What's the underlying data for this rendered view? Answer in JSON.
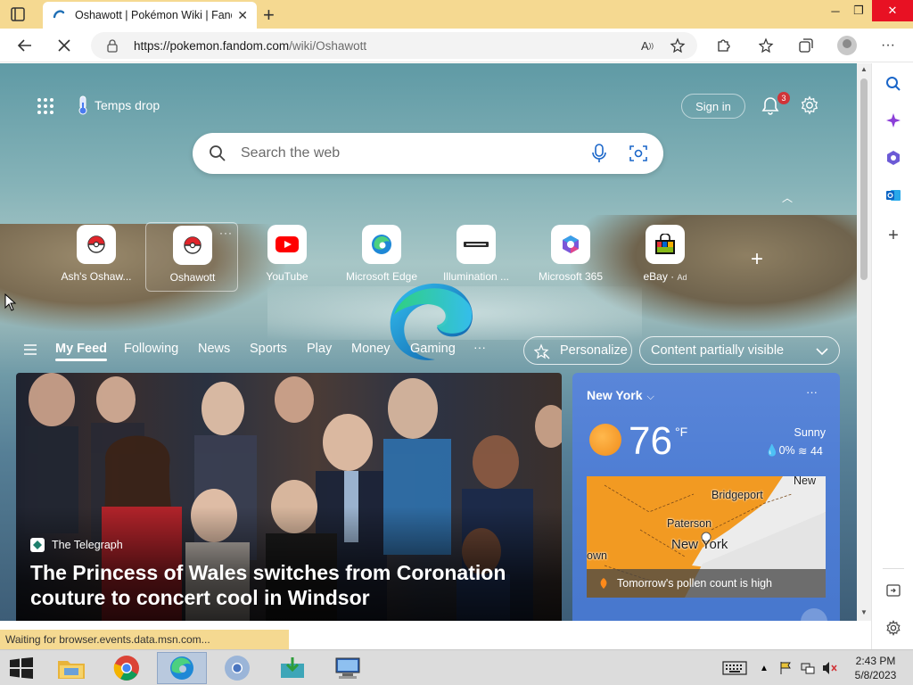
{
  "browser": {
    "tab_title": "Oshawott | Pokémon Wiki | Fandom",
    "url_host": "https://pokemon.fandom.com",
    "url_path": "/wiki/Oshawott"
  },
  "newtab": {
    "weather_chip": "Temps drop",
    "sign_in": "Sign in",
    "notification_count": "3",
    "search_placeholder": "Search the web",
    "tiles": [
      {
        "label": "Ash's Oshaw...",
        "icon": "pokeball-icon"
      },
      {
        "label": "Oshawott",
        "icon": "pokeball-icon"
      },
      {
        "label": "YouTube",
        "icon": "youtube-icon"
      },
      {
        "label": "Microsoft Edge",
        "icon": "edge-icon"
      },
      {
        "label": "Illumination ...",
        "icon": "illumination-icon"
      },
      {
        "label": "Microsoft 365",
        "icon": "microsoft-365-icon"
      },
      {
        "label": "eBay",
        "ad": "Ad",
        "icon": "ebay-icon"
      }
    ],
    "feed_nav": [
      "My Feed",
      "Following",
      "News",
      "Sports",
      "Play",
      "Money",
      "Gaming"
    ],
    "personalize": "Personalize",
    "content_visibility": "Content partially visible"
  },
  "hero": {
    "source": "The Telegraph",
    "title": "The Princess of Wales switches from Coronation couture to concert cool in Windsor"
  },
  "weather": {
    "location": "New York",
    "temperature": "76",
    "unit": "°F",
    "condition": "Sunny",
    "precip": "0%",
    "aqi": "44",
    "map_labels": [
      "Bridgeport",
      "Paterson",
      "New York",
      "own",
      "New"
    ],
    "pollen": "Tomorrow's pollen count is high"
  },
  "status_text": "Waiting for browser.events.data.msn.com...",
  "taskbar": {
    "time": "2:43 PM",
    "date": "5/8/2023"
  },
  "colors": {
    "title_bar": "#f5d991",
    "weather_card": "#5282d6",
    "close_button": "#e81123"
  }
}
